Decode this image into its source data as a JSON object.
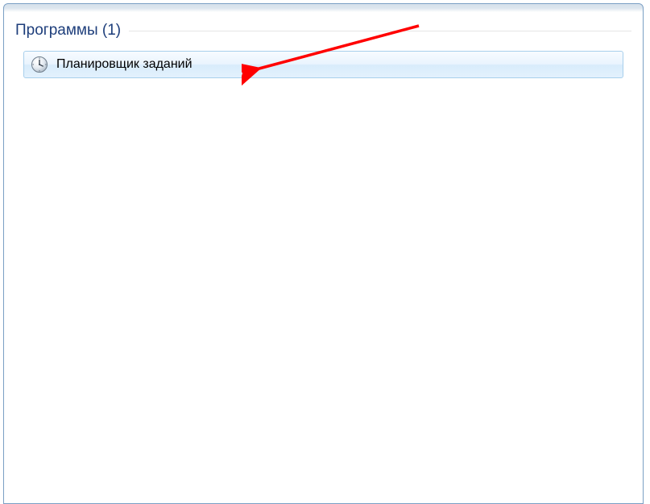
{
  "section": {
    "title": "Программы (1)"
  },
  "results": [
    {
      "label": "Планировщик заданий",
      "icon": "clock-icon"
    }
  ]
}
